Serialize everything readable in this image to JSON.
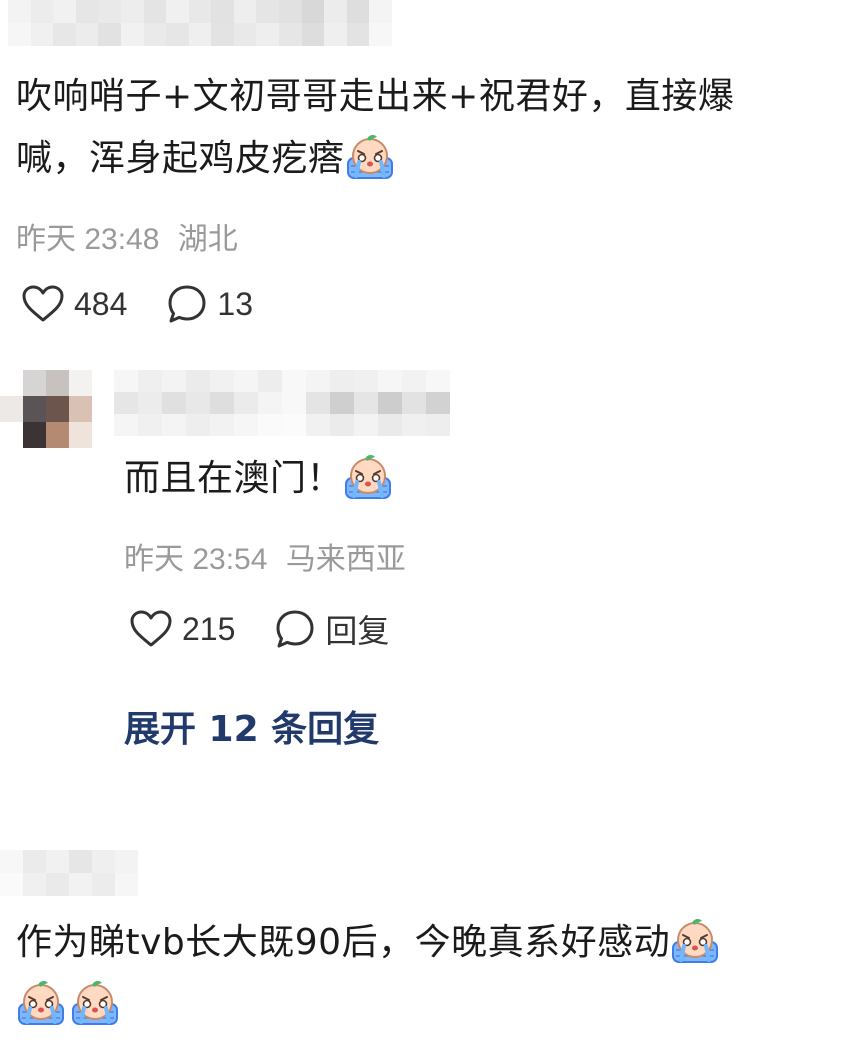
{
  "comments": [
    {
      "text": "吹响哨子+文初哥哥走出来+祝君好，直接爆喊，浑身起鸡皮疙瘩",
      "line1": "吹响哨子+文初哥哥走出来+祝君好，直接爆",
      "line2": "喊，浑身起鸡皮疙瘩",
      "time": "昨天 23:48",
      "location": "湖北",
      "likes": "484",
      "replies": "13",
      "emoji": "crying-emoji"
    },
    {
      "text": "而且在澳门！",
      "time": "昨天 23:54",
      "location": "马来西亚",
      "likes": "215",
      "reply_label": "回复",
      "emoji": "crying-emoji"
    },
    {
      "line1": "作为睇tvb长大既90后，今晚真系好感动",
      "emoji": "crying-emoji"
    }
  ],
  "expand_label": "展开 12 条回复",
  "colors": {
    "meta": "#9a9a9a",
    "expand": "#213a6b",
    "text": "#1b1b1b"
  }
}
